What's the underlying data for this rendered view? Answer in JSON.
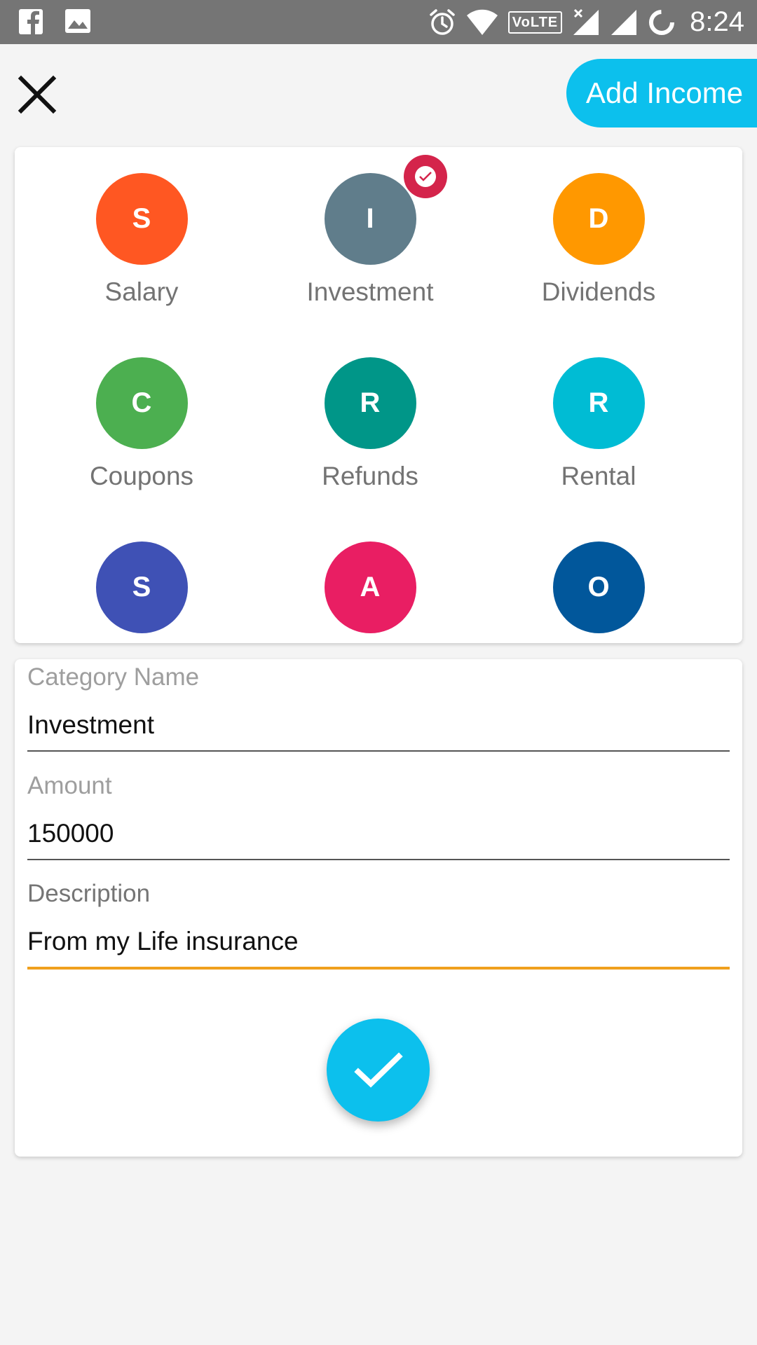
{
  "status_bar": {
    "time": "8:24",
    "volte": "VoLTE",
    "icons": [
      "facebook-icon",
      "image-icon",
      "alarm-icon",
      "wifi-icon",
      "volte-icon",
      "signal-no-sim-icon",
      "signal-icon",
      "battery-ring-icon"
    ]
  },
  "header": {
    "close_icon": "close-icon",
    "add_income_label": "Add Income"
  },
  "colors": {
    "accent": "#0cc0ed",
    "selected_badge": "#d4244b",
    "active_underline": "#f0a01e"
  },
  "categories": [
    {
      "initial": "S",
      "label": "Salary",
      "color": "#ff5722",
      "selected": false
    },
    {
      "initial": "I",
      "label": "Investment",
      "color": "#607d8b",
      "selected": true
    },
    {
      "initial": "D",
      "label": "Dividends",
      "color": "#ff9800",
      "selected": false
    },
    {
      "initial": "C",
      "label": "Coupons",
      "color": "#4caf50",
      "selected": false
    },
    {
      "initial": "R",
      "label": "Refunds",
      "color": "#009688",
      "selected": false
    },
    {
      "initial": "R",
      "label": "Rental",
      "color": "#00bcd4",
      "selected": false
    },
    {
      "initial": "S",
      "label": "",
      "color": "#3f51b5",
      "selected": false
    },
    {
      "initial": "A",
      "label": "",
      "color": "#e91e63",
      "selected": false
    },
    {
      "initial": "O",
      "label": "",
      "color": "#01579b",
      "selected": false
    }
  ],
  "form": {
    "category_name": {
      "label": "Category Name",
      "value": "Investment"
    },
    "amount": {
      "label": "Amount",
      "value": "150000"
    },
    "description": {
      "label": "Description",
      "value": "From my Life insurance"
    },
    "submit_icon": "checkmark-icon"
  }
}
